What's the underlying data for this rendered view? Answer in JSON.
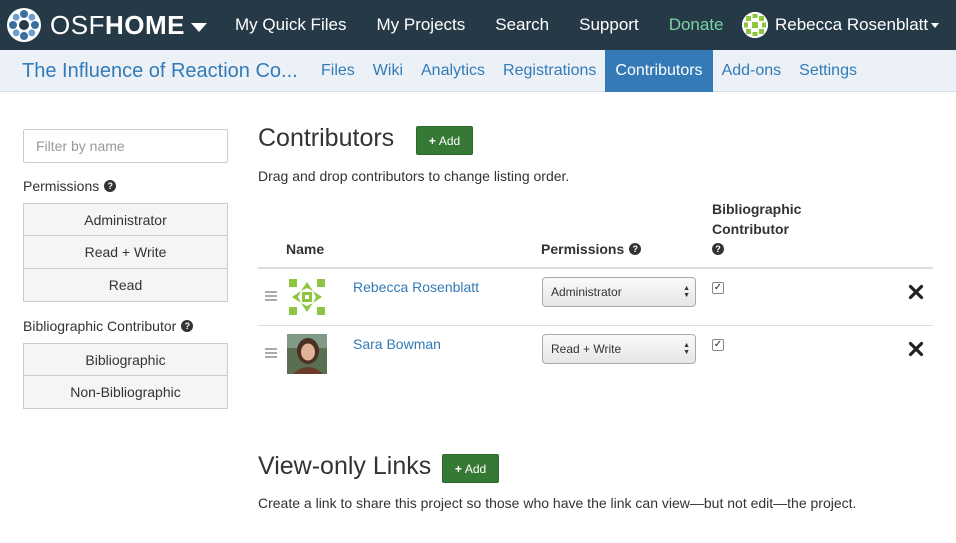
{
  "nav": {
    "brand_osf": "OSF",
    "brand_home": "HOME",
    "items": [
      "My Quick Files",
      "My Projects",
      "Search",
      "Support",
      "Donate"
    ],
    "user_name": "Rebecca Rosenblatt"
  },
  "project": {
    "title": "The Influence of Reaction Co...",
    "tabs": [
      "Files",
      "Wiki",
      "Analytics",
      "Registrations",
      "Contributors",
      "Add-ons",
      "Settings"
    ],
    "active_tab": "Contributors"
  },
  "sidebar": {
    "filter_placeholder": "Filter by name",
    "permissions_label": "Permissions",
    "permissions_options": [
      "Administrator",
      "Read + Write",
      "Read"
    ],
    "bibliographic_label": "Bibliographic Contributor",
    "bibliographic_options": [
      "Bibliographic",
      "Non-Bibliographic"
    ]
  },
  "contributors": {
    "title": "Contributors",
    "add_label": "Add",
    "instructions": "Drag and drop contributors to change listing order.",
    "columns": {
      "name": "Name",
      "permissions": "Permissions",
      "bibliographic_line1": "Bibliographic",
      "bibliographic_line2": "Contributor"
    },
    "rows": [
      {
        "name": "Rebecca Rosenblatt",
        "permission": "Administrator",
        "bibliographic": true
      },
      {
        "name": "Sara Bowman",
        "permission": "Read + Write",
        "bibliographic": true
      }
    ]
  },
  "view_only": {
    "title": "View-only Links",
    "add_label": "Add",
    "description": "Create a link to share this project so those who have the link can view—but not edit—the project."
  },
  "colors": {
    "navbar": "#263947",
    "donate": "#79d2a6",
    "link": "#337ab7",
    "subnav_bg": "#ebf1f6",
    "add_button": "#357935",
    "identicon": "#8cc63f"
  }
}
